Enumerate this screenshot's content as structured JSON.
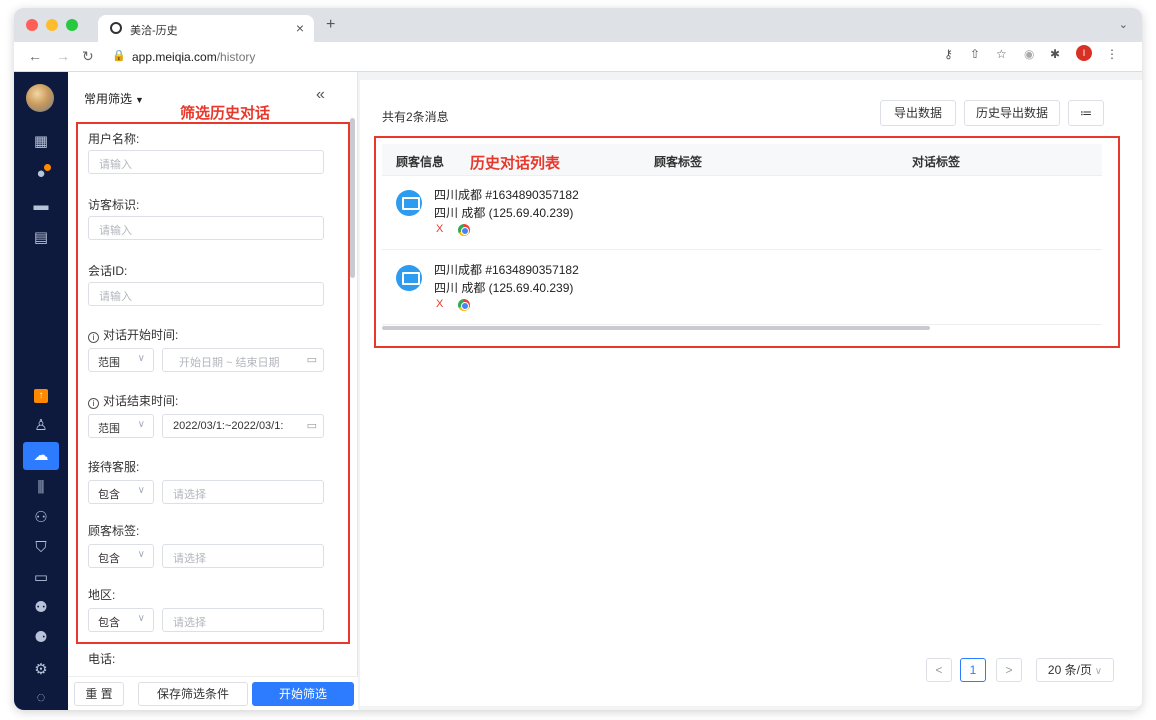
{
  "browser": {
    "tab_title": "美洽-历史",
    "tab_close": "×",
    "new_tab": "+",
    "url_host": "app.meiqia.com",
    "url_path": "/history",
    "profile_initial": "I"
  },
  "filter": {
    "header": "常用筛选",
    "collapse": "«",
    "annotation": "筛选历史对话",
    "fields": {
      "username_label": "用户名称:",
      "username_placeholder": "请输入",
      "visitor_label": "访客标识:",
      "visitor_placeholder": "请输入",
      "session_label": "会话ID:",
      "session_placeholder": "请输入",
      "start_label": "对话开始时间:",
      "start_mode": "范围",
      "start_range_placeholder": "开始日期 ~ 结束日期",
      "end_label": "对话结束时间:",
      "end_mode": "范围",
      "end_range_value": "2022/03/1:~2022/03/1:",
      "agent_label": "接待客服:",
      "agent_mode": "包含",
      "agent_placeholder": "请选择",
      "tag_label": "顾客标签:",
      "tag_mode": "包含",
      "tag_placeholder": "请选择",
      "region_label": "地区:",
      "region_mode": "包含",
      "region_placeholder": "请选择",
      "phone_label": "电话:"
    },
    "buttons": {
      "reset": "重 置",
      "save": "保存筛选条件",
      "start": "开始筛选"
    }
  },
  "main": {
    "count_text": "共有2条消息",
    "export_label": "导出数据",
    "history_export_label": "历史导出数据",
    "columns_icon": "≔",
    "annotation": "历史对话列表",
    "table": {
      "headers": [
        "顾客信息",
        "顾客标签",
        "对话标签"
      ],
      "rows": [
        {
          "name": "四川成都 #1634890357182",
          "location": "四川 成都 (125.69.40.239)"
        },
        {
          "name": "四川成都 #1634890357182",
          "location": "四川 成都 (125.69.40.239)"
        }
      ]
    },
    "pagination": {
      "prev": "<",
      "current": "1",
      "next": ">",
      "page_size": "20 条/页"
    }
  },
  "colors": {
    "accent": "#2d7cff",
    "annotation_red": "#e8382b",
    "nav_bg": "#0e1a3d"
  },
  "icons": {
    "nav": [
      "dashboard-icon",
      "chat-icon",
      "message-icon",
      "clipboard-icon",
      "upgrade-icon",
      "user-icon",
      "history-icon",
      "stats-icon",
      "team-icon",
      "shield-icon",
      "monitor-icon",
      "robot-icon",
      "contacts-icon",
      "settings-icon",
      "help-icon"
    ]
  }
}
